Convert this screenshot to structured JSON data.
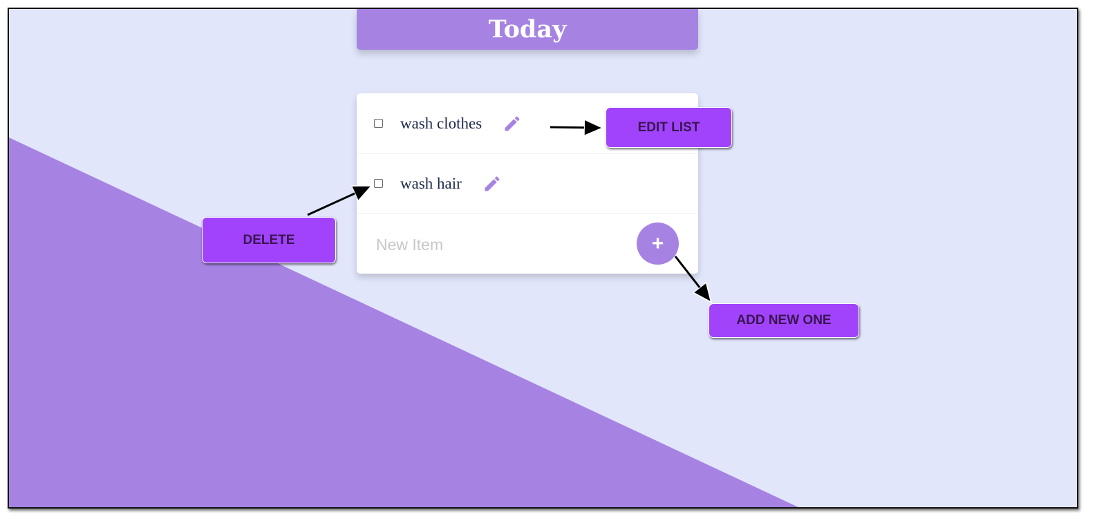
{
  "header": {
    "title": "Today"
  },
  "list": {
    "items": [
      {
        "label": "wash clothes",
        "checked": false
      },
      {
        "label": "wash hair",
        "checked": false
      }
    ],
    "new_item_placeholder": "New Item",
    "add_button_label": "+"
  },
  "callouts": {
    "edit": "EDIT LIST",
    "delete": "DELETE",
    "add": "ADD NEW ONE"
  },
  "colors": {
    "background": "#e2e6fb",
    "accent": "#a683e3",
    "callout": "#a043fa",
    "text": "#1d2a4a"
  },
  "icons": {
    "edit": "pencil-icon",
    "add": "plus-icon"
  }
}
